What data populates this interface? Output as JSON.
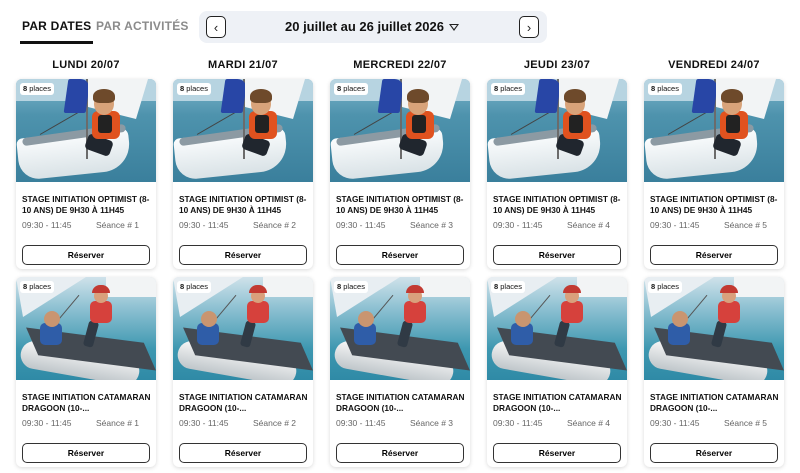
{
  "tabs": {
    "by_dates": "PAR DATES",
    "by_activities": "PAR ACTIVITÉS"
  },
  "date_nav": {
    "prev": "‹",
    "next": "›",
    "range": "20 juillet au 26 juillet 2026"
  },
  "reserve_label": "Réserver",
  "days": [
    {
      "label": "LUNDI 20/07",
      "cards": [
        {
          "places": "8",
          "places_label": "places",
          "title": "STAGE INITIATION OPTIMIST (8-10 ANS) DE 9H30 À 11H45",
          "time": "09:30 - 11:45",
          "session": "Séance # 1"
        },
        {
          "places": "8",
          "places_label": "places",
          "title": "STAGE INITIATION CATAMARAN DRAGOON (10-...",
          "time": "09:30 - 11:45",
          "session": "Séance # 1"
        }
      ]
    },
    {
      "label": "MARDI 21/07",
      "cards": [
        {
          "places": "8",
          "places_label": "places",
          "title": "STAGE INITIATION OPTIMIST (8-10 ANS) DE 9H30 À 11H45",
          "time": "09:30 - 11:45",
          "session": "Séance # 2"
        },
        {
          "places": "8",
          "places_label": "places",
          "title": "STAGE INITIATION CATAMARAN DRAGOON (10-...",
          "time": "09:30 - 11:45",
          "session": "Séance # 2"
        }
      ]
    },
    {
      "label": "MERCREDI 22/07",
      "cards": [
        {
          "places": "8",
          "places_label": "places",
          "title": "STAGE INITIATION OPTIMIST (8-10 ANS) DE 9H30 À 11H45",
          "time": "09:30 - 11:45",
          "session": "Séance # 3"
        },
        {
          "places": "8",
          "places_label": "places",
          "title": "STAGE INITIATION CATAMARAN DRAGOON (10-...",
          "time": "09:30 - 11:45",
          "session": "Séance # 3"
        }
      ]
    },
    {
      "label": "JEUDI 23/07",
      "cards": [
        {
          "places": "8",
          "places_label": "places",
          "title": "STAGE INITIATION OPTIMIST (8-10 ANS) DE 9H30 À 11H45",
          "time": "09:30 - 11:45",
          "session": "Séance # 4"
        },
        {
          "places": "8",
          "places_label": "places",
          "title": "STAGE INITIATION CATAMARAN DRAGOON (10-...",
          "time": "09:30 - 11:45",
          "session": "Séance # 4"
        }
      ]
    },
    {
      "label": "VENDREDI 24/07",
      "cards": [
        {
          "places": "8",
          "places_label": "places",
          "title": "STAGE INITIATION OPTIMIST (8-10 ANS) DE 9H30 À 11H45",
          "time": "09:30 - 11:45",
          "session": "Séance # 5"
        },
        {
          "places": "8",
          "places_label": "places",
          "title": "STAGE INITIATION CATAMARAN DRAGOON (10-...",
          "time": "09:30 - 11:45",
          "session": "Séance # 5"
        }
      ]
    }
  ]
}
